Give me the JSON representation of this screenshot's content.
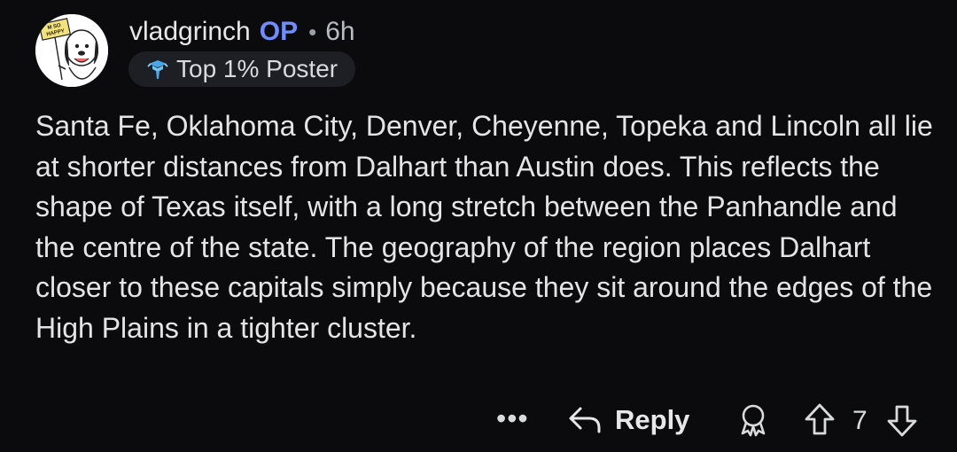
{
  "comment": {
    "username": "vladgrinch",
    "op_badge": "OP",
    "separator": "•",
    "time_ago": "6h",
    "flair": "Top 1% Poster",
    "avatar_sign_text": "M SO HAPPY",
    "body": "Santa Fe, Oklahoma City, Denver, Cheyenne, Topeka and Lincoln all lie at shorter distances from Dalhart than Austin does. This reflects the shape of Texas itself, with a long stretch between the Panhandle and the centre of the state. The geography of the region places Dalhart closer to these capitals simply because they sit around the edges of the High Plains in a tighter cluster."
  },
  "actions": {
    "more_label": "•••",
    "reply_label": "Reply",
    "score": "7"
  },
  "colors": {
    "background": "#0b0b0d",
    "text": "#e7e7ea",
    "op": "#6f8dff",
    "flair_bg": "#1e1f24"
  },
  "icons": [
    "avatar-icon",
    "top-poster-icon",
    "reply-icon",
    "award-icon",
    "upvote-icon",
    "downvote-icon"
  ]
}
